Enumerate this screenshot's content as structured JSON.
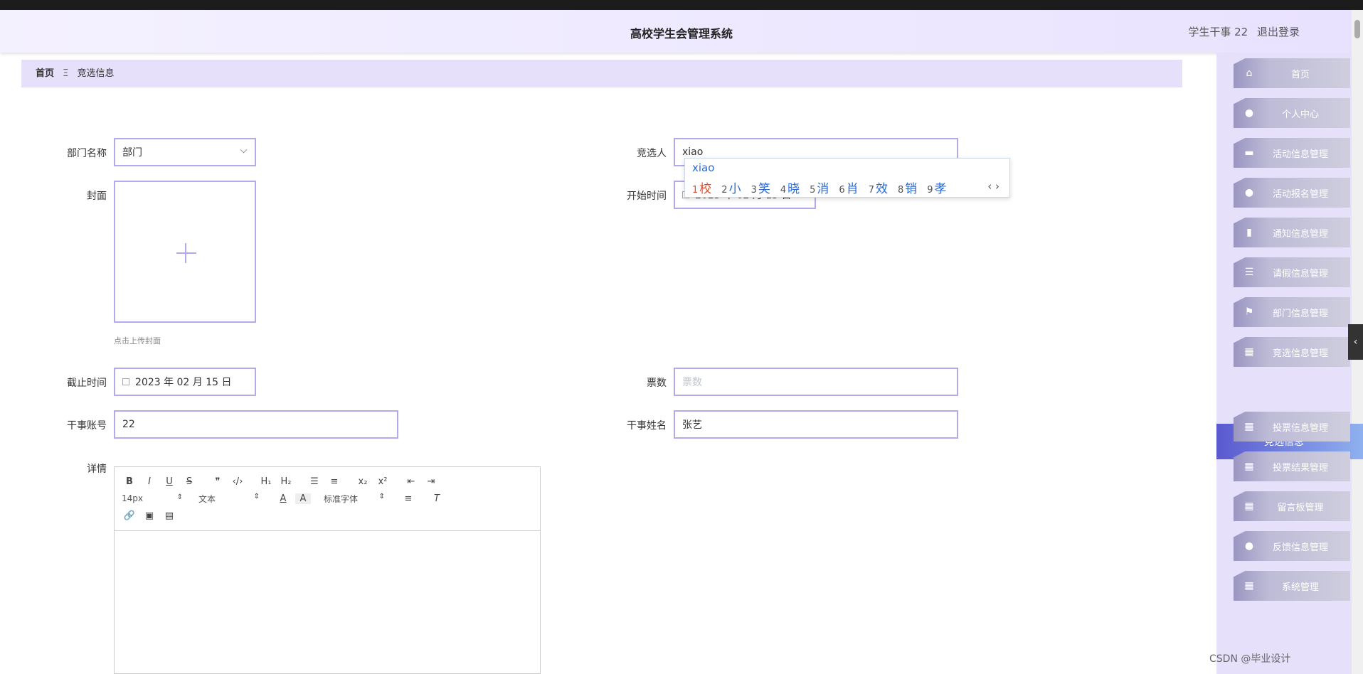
{
  "header": {
    "title": "高校学生会管理系统",
    "user": "学生干事 22",
    "logout": "退出登录"
  },
  "breadcrumb": {
    "home": "首页",
    "separator": "Ξ",
    "current": "竞选信息"
  },
  "form": {
    "dept_label": "部门名称",
    "dept_value": "部门",
    "candidate_label": "竞选人",
    "candidate_value": "xiao",
    "cover_label": "封面",
    "cover_hint": "点击上传封面",
    "start_label": "开始时间",
    "start_value": "2023 年 02 月 15 日",
    "end_label": "截止时间",
    "end_value": "2023 年 02 月 15 日",
    "votes_label": "票数",
    "votes_placeholder": "票数",
    "account_label": "干事账号",
    "account_value": "22",
    "name_label": "干事姓名",
    "name_value": "张艺",
    "detail_label": "详情"
  },
  "editor": {
    "font_size": "14px",
    "block_type": "文本",
    "font_family": "标准字体",
    "row1": [
      "B",
      "I",
      "U",
      "S",
      "❞",
      "‹/›",
      "H₁",
      "H₂",
      "☰",
      "≡",
      "x₂",
      "x²",
      "⇤",
      "⇥"
    ],
    "row3": [
      "🔗",
      "▣",
      "▤"
    ]
  },
  "ime": {
    "composition": "xiao",
    "candidates": [
      {
        "n": "1",
        "c": "校"
      },
      {
        "n": "2",
        "c": "小"
      },
      {
        "n": "3",
        "c": "笑"
      },
      {
        "n": "4",
        "c": "晓"
      },
      {
        "n": "5",
        "c": "消"
      },
      {
        "n": "6",
        "c": "肖"
      },
      {
        "n": "7",
        "c": "效"
      },
      {
        "n": "8",
        "c": "销"
      },
      {
        "n": "9",
        "c": "孝"
      }
    ],
    "nav": "‹ ›"
  },
  "sidebar": {
    "items": [
      {
        "label": "首页",
        "icon": "⌂"
      },
      {
        "label": "个人中心",
        "icon": "●"
      },
      {
        "label": "活动信息管理",
        "icon": "▬"
      },
      {
        "label": "活动报名管理",
        "icon": "●"
      },
      {
        "label": "通知信息管理",
        "icon": "▮"
      },
      {
        "label": "请假信息管理",
        "icon": "☰"
      },
      {
        "label": "部门信息管理",
        "icon": "⚑"
      },
      {
        "label": "竞选信息管理",
        "icon": "▦"
      },
      {
        "label": "投票信息管理",
        "icon": "▦"
      },
      {
        "label": "投票结果管理",
        "icon": "▦"
      },
      {
        "label": "留言板管理",
        "icon": "▦"
      },
      {
        "label": "反馈信息管理",
        "icon": "●"
      },
      {
        "label": "系统管理",
        "icon": "▦"
      }
    ],
    "active": "竞选信息"
  },
  "watermark": "CSDN @毕业设计"
}
